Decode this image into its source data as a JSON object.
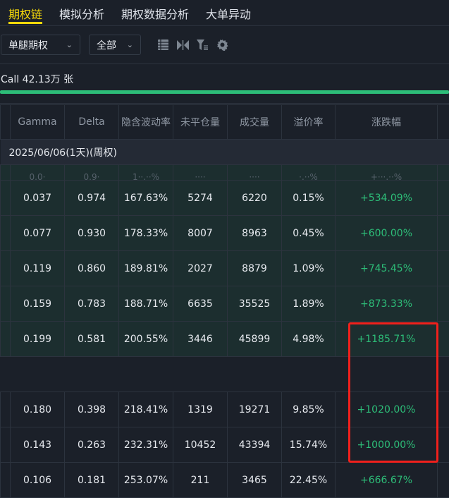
{
  "tabs": [
    "期权链",
    "模拟分析",
    "期权数据分析",
    "大单异动"
  ],
  "toolbar": {
    "leg_select": "单腿期权",
    "range_select": "全部",
    "icons": [
      "list-icon",
      "split-icon",
      "filter-icon",
      "gear-icon"
    ]
  },
  "summary": {
    "call_text": "Call 42.13万 张",
    "call_bar_fraction": 1.0,
    "bar_color": "#2dbd78"
  },
  "table": {
    "headers": [
      "Gamma",
      "Delta",
      "隐含波动率",
      "未平仓量",
      "成交量",
      "溢价率",
      "涨跌幅"
    ],
    "expiry": "2025/06/06(1天)(周权)",
    "itm_rows": [
      [
        "0.037",
        "0.974",
        "167.63%",
        "5274",
        "6220",
        "0.15%",
        "+534.09%"
      ],
      [
        "0.077",
        "0.930",
        "178.33%",
        "8007",
        "8963",
        "0.45%",
        "+600.00%"
      ],
      [
        "0.119",
        "0.860",
        "189.81%",
        "2027",
        "8879",
        "1.09%",
        "+745.45%"
      ],
      [
        "0.159",
        "0.783",
        "188.71%",
        "6635",
        "35525",
        "1.89%",
        "+873.33%"
      ],
      [
        "0.199",
        "0.581",
        "200.55%",
        "3446",
        "45899",
        "4.98%",
        "+1185.71%"
      ]
    ],
    "otm_rows": [
      [
        "0.180",
        "0.398",
        "218.41%",
        "1319",
        "19271",
        "9.85%",
        "+1020.00%"
      ],
      [
        "0.143",
        "0.263",
        "232.31%",
        "10452",
        "43394",
        "15.74%",
        "+1000.00%"
      ],
      [
        "0.106",
        "0.181",
        "253.07%",
        "211",
        "3465",
        "22.45%",
        "+666.67%"
      ]
    ]
  }
}
